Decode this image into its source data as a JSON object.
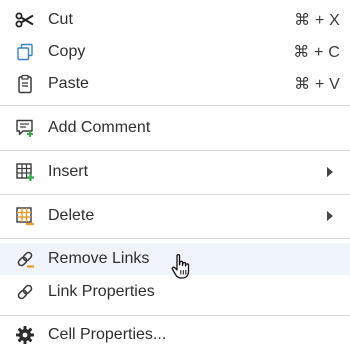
{
  "menu": {
    "cut": {
      "label": "Cut",
      "shortcut": "⌘ + X",
      "icon": "scissors-icon"
    },
    "copy": {
      "label": "Copy",
      "shortcut": "⌘ + C",
      "icon": "copy-icon"
    },
    "paste": {
      "label": "Paste",
      "shortcut": "⌘ + V",
      "icon": "clipboard-icon"
    },
    "add_comment": {
      "label": "Add Comment",
      "icon": "add-comment-icon"
    },
    "insert": {
      "label": "Insert",
      "icon": "table-insert-icon",
      "has_submenu": true
    },
    "delete": {
      "label": "Delete",
      "icon": "table-delete-icon",
      "has_submenu": true
    },
    "remove_links": {
      "label": "Remove Links",
      "icon": "unlink-icon",
      "hovered": true
    },
    "link_properties": {
      "label": "Link Properties",
      "icon": "link-icon"
    },
    "cell_properties": {
      "label": "Cell Properties...",
      "icon": "gear-icon"
    }
  },
  "colors": {
    "hover_bg": "#eef4fa",
    "icon_blue": "#3b82c4",
    "icon_green": "#3aaa4a",
    "icon_orange": "#e59a2b",
    "separator": "#d9d9d9"
  }
}
